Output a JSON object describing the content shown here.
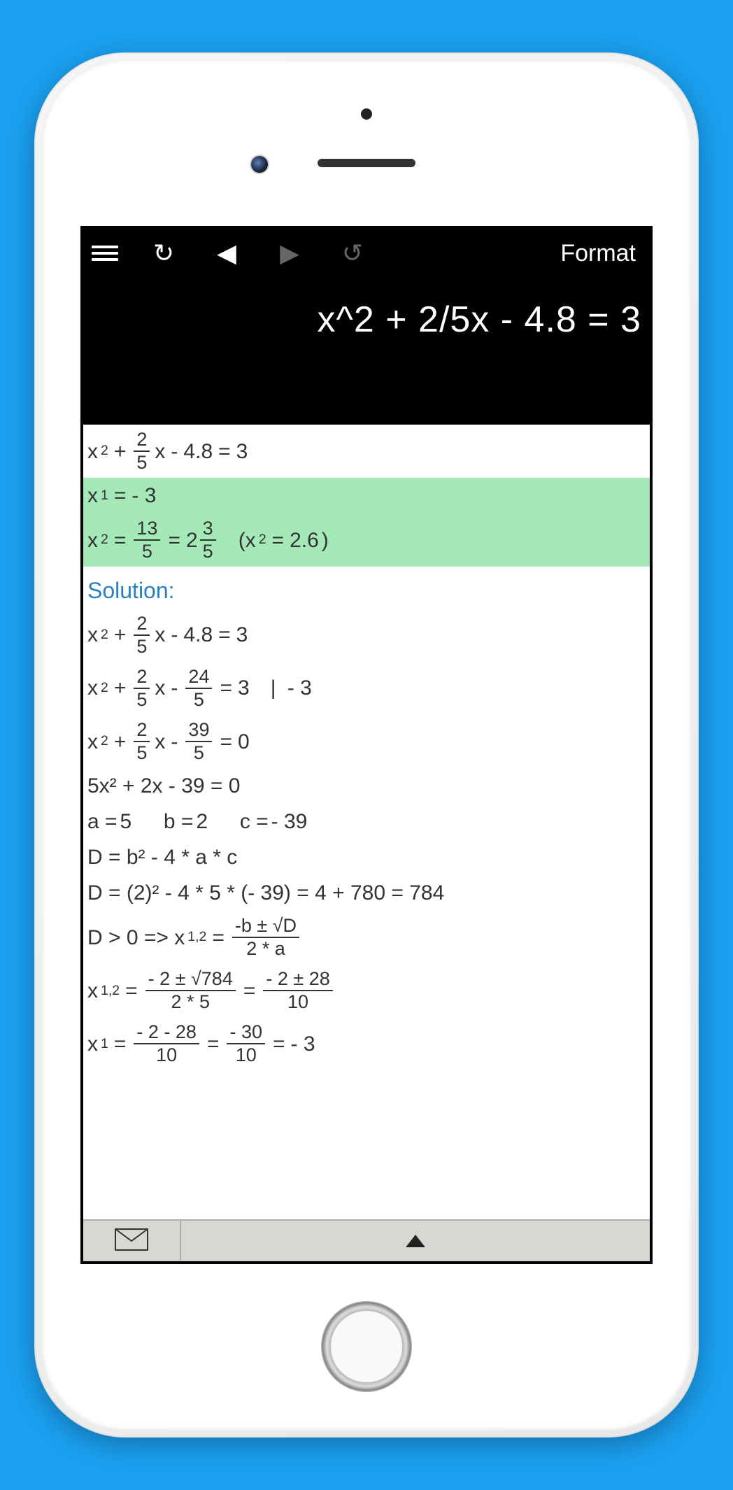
{
  "toolbar": {
    "format_label": "Format"
  },
  "input": {
    "expression": "x^2 + 2/5x - 4.8 = 3"
  },
  "original": {
    "f1n": "2",
    "f1d": "5",
    "rhs": "3",
    "const": "4.8"
  },
  "roots": {
    "x1": "- 3",
    "x2_frac_n": "13",
    "x2_frac_d": "5",
    "x2_mixed_whole": "2",
    "x2_mixed_n": "3",
    "x2_mixed_d": "5",
    "x2_decimal": "2.6"
  },
  "solution": {
    "label": "Solution:",
    "step2_fn": "24",
    "step2_fd": "5",
    "step2_rhs": "3",
    "step2_note": "- 3",
    "step3_fn": "39",
    "step3_fd": "5",
    "step4": "5x² + 2x - 39 = 0",
    "abc": {
      "a": "5",
      "b": "2",
      "c": "- 39"
    },
    "disc_formula": "D = b² - 4 * a * c",
    "disc_calc": "D = (2)² - 4 * 5 * (- 39) = 4 + 780 = 784",
    "cond": "D > 0 => x",
    "qform_n": "-b ± √D",
    "qform_d": "2 * a",
    "x12_a_n": "- 2 ± √784",
    "x12_a_d": "2 * 5",
    "x12_b_n": "- 2 ± 28",
    "x12_b_d": "10",
    "x1_a_n": "- 2 - 28",
    "x1_a_d": "10",
    "x1_b_n": "- 30",
    "x1_b_d": "10",
    "x1_res": "- 3"
  }
}
